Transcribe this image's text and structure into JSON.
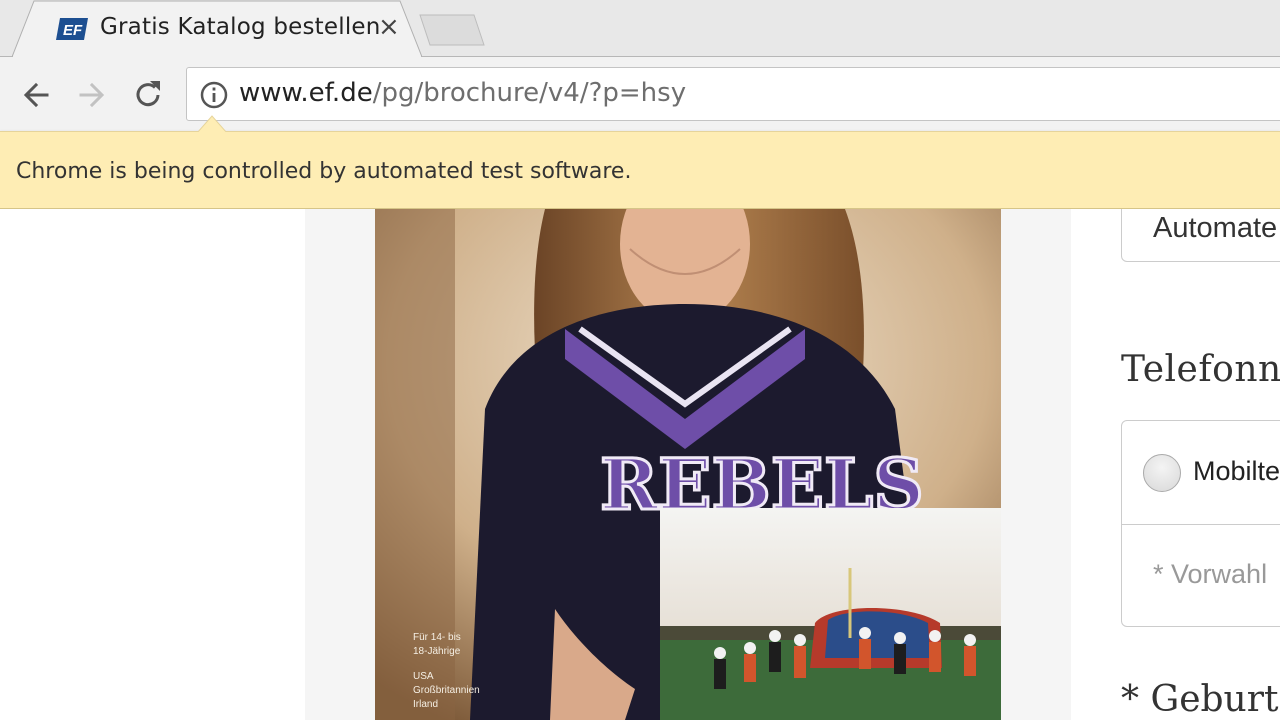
{
  "browser": {
    "tab": {
      "favicon_text": "EF",
      "title": "Gratis Katalog bestellen",
      "close_symbol": "×"
    },
    "nav": {
      "back_icon": "arrow-left-icon",
      "forward_icon": "arrow-right-icon",
      "reload_icon": "reload-icon"
    },
    "address": {
      "info_icon": "info-icon",
      "domain": "www.ef.de",
      "path": "/pg/brochure/v4/?p=hsy"
    },
    "infobar": {
      "message": "Chrome is being controlled by automated test software."
    }
  },
  "page": {
    "catalog": {
      "caption_line1": "Für 14- bis",
      "caption_line2": "18-Jährige",
      "caption_line3": "USA",
      "caption_line4": "Großbritannien",
      "caption_line5": "Irland",
      "jersey_text": "REBELS",
      "colors": {
        "jersey": "#1c1a2e",
        "accent": "#6e4ea8"
      }
    },
    "form": {
      "top_field_value": "Automate",
      "phone_label": "Telefonnu",
      "mobile_radio_label": "Mobilte",
      "area_code_placeholder": "* Vorwahl",
      "birth_label": "* Geburts"
    }
  }
}
